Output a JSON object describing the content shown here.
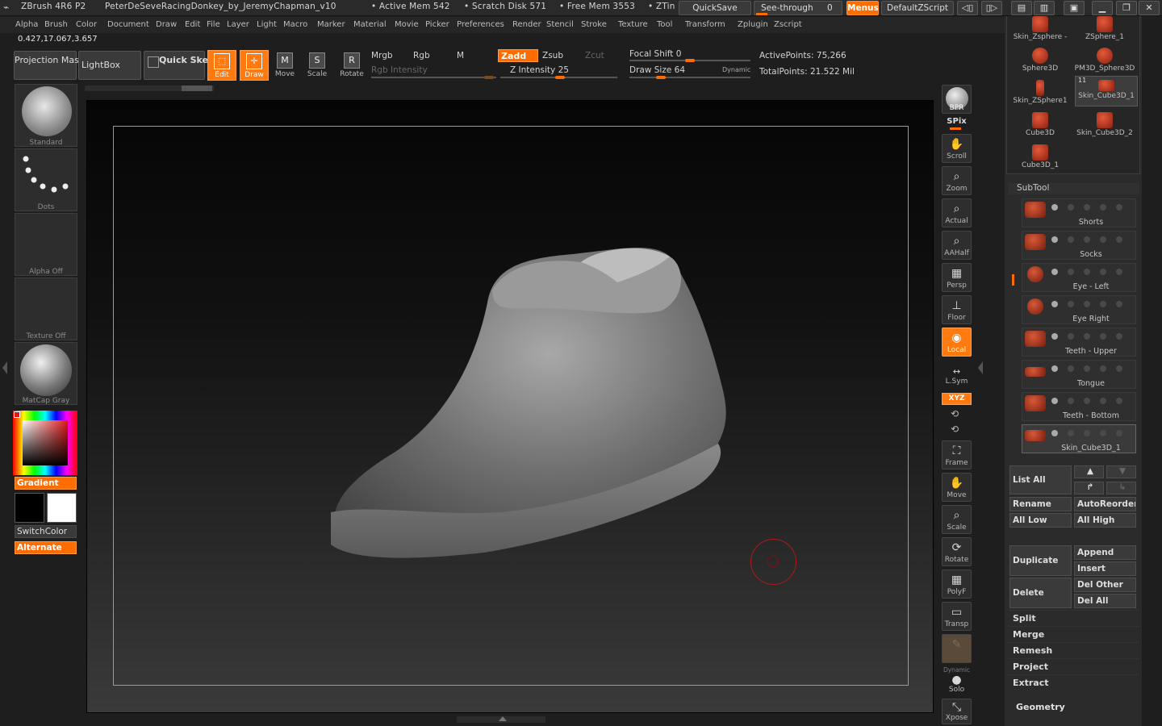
{
  "title_bar": {
    "app": "ZBrush 4R6 P2",
    "document": "PeterDeSeveRacingDonkey_by_JeremyChapman_v10",
    "active_mem": "• Active Mem 542",
    "scratch_disk": "• Scratch Disk 571",
    "free_mem": "• Free Mem 3553",
    "ztime": "• ZTin",
    "quicksave": "QuickSave",
    "see_through": "See-through",
    "see_through_value": "0",
    "menus": "Menus",
    "script": "DefaultZScript"
  },
  "menu": [
    "Alpha",
    "Brush",
    "Color",
    "Document",
    "Draw",
    "Edit",
    "File",
    "Layer",
    "Light",
    "Macro",
    "Marker",
    "Material",
    "Movie",
    "Picker",
    "Preferences",
    "Render",
    "Stencil",
    "Stroke",
    "Texture",
    "Tool",
    "Transform",
    "Zplugin",
    "Zscript"
  ],
  "coords": "0.427,17.067,3.657",
  "shelf": {
    "projection_master": "Projection Master",
    "lightbox": "LightBox",
    "quick_sketch": "Quick Sketch",
    "edit": "Edit",
    "draw": "Draw",
    "move": "Move",
    "scale": "Scale",
    "rotate": "Rotate",
    "mrgb": "Mrgb",
    "rgb": "Rgb",
    "m": "M",
    "rgb_intensity": "Rgb Intensity",
    "zadd": "Zadd",
    "zsub": "Zsub",
    "zcut": "Zcut",
    "z_intensity": "Z Intensity 25",
    "focal_shift": "Focal Shift 0",
    "draw_size": "Draw Size 64",
    "dynamic": "Dynamic",
    "active_points": "ActivePoints: 75,266",
    "total_points": "TotalPoints: 21.522 Mil"
  },
  "left": {
    "brush": "Standard",
    "stroke": "Dots",
    "alpha": "Alpha Off",
    "texture": "Texture Off",
    "material": "MatCap Gray",
    "gradient": "Gradient",
    "switch_color": "SwitchColor",
    "alternate": "Alternate"
  },
  "right_tools": {
    "bpr": "BPR",
    "spix": "SPix",
    "scroll": "Scroll",
    "zoom": "Zoom",
    "actual": "Actual",
    "aahalf": "AAHalf",
    "persp": "Persp",
    "floor": "Floor",
    "local": "Local",
    "lsym": "L.Sym",
    "xyz": "XYZ",
    "frame": "Frame",
    "move": "Move",
    "scale": "Scale",
    "rotate": "Rotate",
    "polyf": "PolyF",
    "transp": "Transp",
    "dynamic": "Dynamic",
    "solo": "Solo",
    "xpose": "Xpose"
  },
  "tool_tiles": [
    {
      "name": "Skin_Zsphere -"
    },
    {
      "name": "ZSphere_1"
    },
    {
      "name": "Sphere3D"
    },
    {
      "name": "PM3D_Sphere3D"
    },
    {
      "name": "Skin_ZSphere1"
    },
    {
      "name": "Skin_Cube3D_1",
      "badge": "11"
    },
    {
      "name": "Cube3D"
    },
    {
      "name": "Skin_Cube3D_2"
    },
    {
      "name": "Cube3D_1"
    }
  ],
  "subtool": {
    "header": "SubTool",
    "items": [
      "Shorts",
      "Socks",
      "Eye - Left",
      "Eye Right",
      "Teeth - Upper",
      "Tongue",
      "Teeth - Bottom",
      "Skin_Cube3D_1"
    ],
    "list_all": "List All",
    "rename": "Rename",
    "auto_reorder": "AutoReorder",
    "all_low": "All Low",
    "all_high": "All High",
    "duplicate": "Duplicate",
    "append": "Append",
    "insert": "Insert",
    "delete": "Delete",
    "del_other": "Del Other",
    "del_all": "Del All",
    "split": "Split",
    "merge": "Merge",
    "remesh": "Remesh",
    "project": "Project",
    "extract": "Extract"
  },
  "geometry": "Geometry",
  "colors": {
    "accent": "#ff6c00",
    "mesh": "#8a8a8a",
    "cursor": "#b01818"
  }
}
